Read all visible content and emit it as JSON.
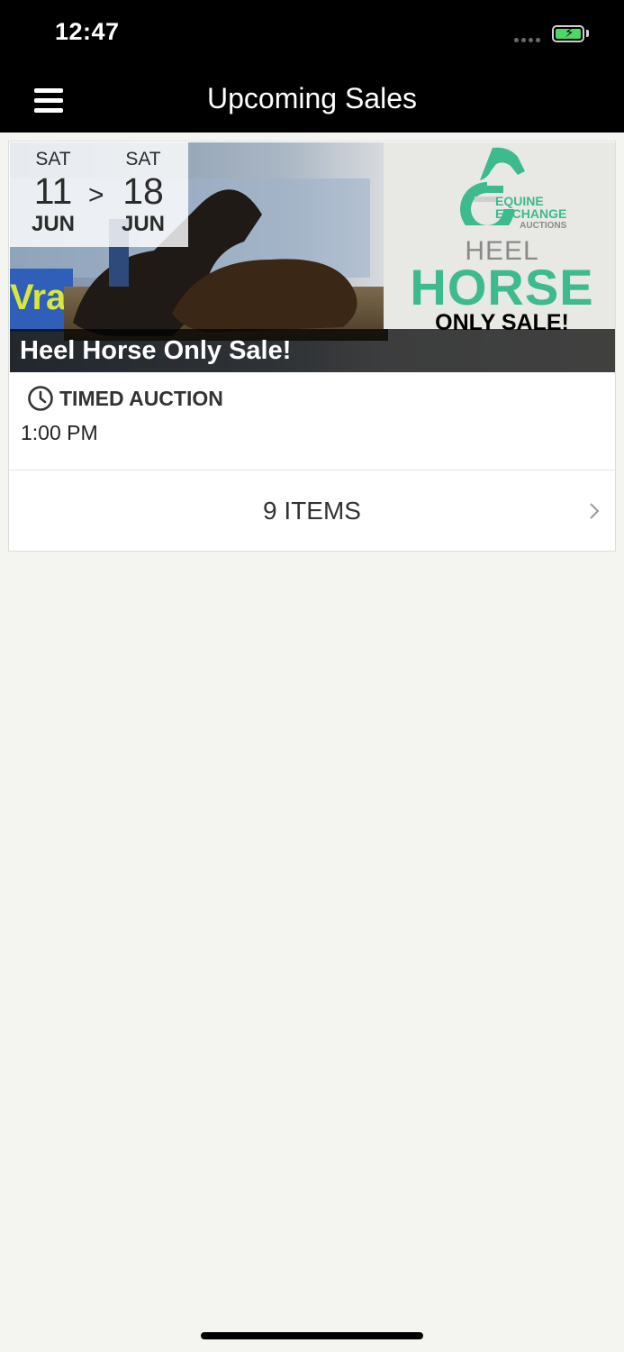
{
  "status_bar": {
    "time": "12:47",
    "battery_color": "#4cd964"
  },
  "nav": {
    "title": "Upcoming Sales",
    "menu_icon": "menu-icon"
  },
  "sale": {
    "start": {
      "dow": "SAT",
      "day": "11",
      "month": "JUN"
    },
    "end": {
      "dow": "SAT",
      "day": "18",
      "month": "JUN"
    },
    "separator": ">",
    "banner": {
      "logo_line1": "EQUINE",
      "logo_line2": "EXCHANGE",
      "logo_line3": "AUCTIONS",
      "heel": "HEEL",
      "horse": "HORSE",
      "only": "ONLY SALE!",
      "accent_color": "#3dba8e"
    },
    "title": "Heel Horse Only Sale!",
    "auction_type": "TIMED AUCTION",
    "auction_icon": "clock-icon",
    "time": "1:00 PM",
    "items_label": "9 ITEMS",
    "chevron_icon": "chevron-right-icon"
  }
}
